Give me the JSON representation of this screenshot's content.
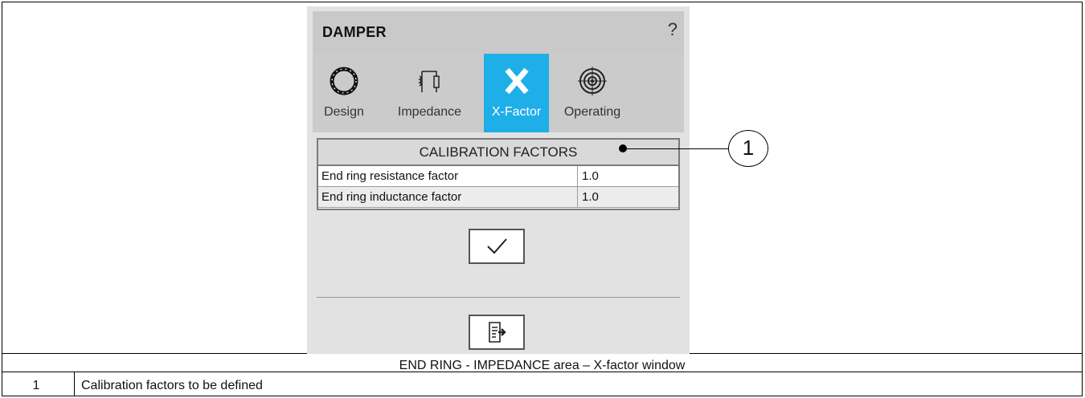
{
  "window": {
    "title": "DAMPER",
    "help_symbol": "?"
  },
  "tabs": [
    {
      "label": "Design",
      "icon": "ring-icon",
      "active": false
    },
    {
      "label": "Impedance",
      "icon": "impedance-icon",
      "active": false
    },
    {
      "label": "X-Factor",
      "icon": "x-icon",
      "active": true
    },
    {
      "label": "Operating",
      "icon": "target-icon",
      "active": false
    }
  ],
  "calibration": {
    "header": "CALIBRATION FACTORS",
    "rows": [
      {
        "label": "End ring resistance factor",
        "value": "1.0"
      },
      {
        "label": "End ring inductance factor",
        "value": "1.0"
      }
    ]
  },
  "buttons": {
    "ok_icon": "check-icon",
    "export_icon": "export-icon"
  },
  "callout": {
    "number": "1"
  },
  "caption": "END RING - IMPEDANCE area – X-factor window",
  "legend": [
    {
      "number": "1",
      "text": "Calibration factors to be defined"
    }
  ],
  "colors": {
    "active_tab": "#1eaee8",
    "panel_bg": "#e2e2e2",
    "titlebar_bg": "#c9c9c9"
  }
}
